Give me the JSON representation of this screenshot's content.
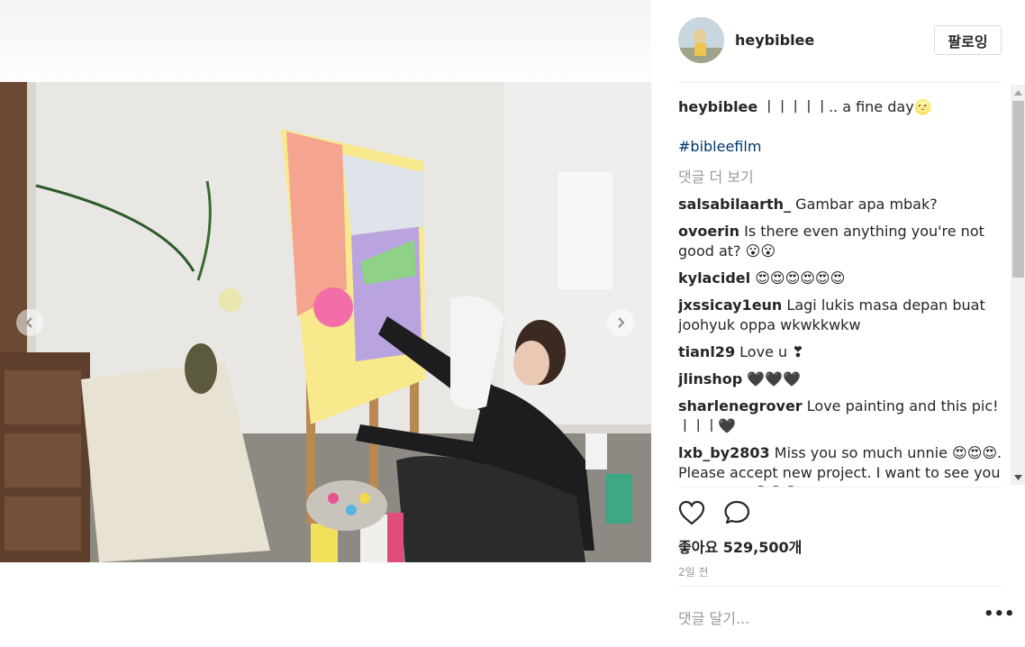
{
  "post": {
    "username": "heybiblee",
    "follow_label": "팔로잉",
    "caption_user": "heybiblee",
    "caption_text": "ㅣㅣㅣㅣㅣ.. a fine day🌝",
    "hashtag": "#bibleefilm",
    "more_comments": "댓글 더 보기",
    "comments": [
      {
        "user": "salsabilaarth_",
        "text": "Gambar apa mbak?"
      },
      {
        "user": "ovoerin",
        "text": "Is there even anything you're not good at? 😮😮"
      },
      {
        "user": "kylacidel",
        "text": "😍😍😍😍😍😍"
      },
      {
        "user": "jxssicay1eun",
        "text": "Lagi lukis masa depan buat joohyuk oppa wkwkkwkw"
      },
      {
        "user": "tianl29",
        "text": "Love u ❣"
      },
      {
        "user": "jlinshop",
        "text": "🖤🖤🖤"
      },
      {
        "user": "sharlenegrover",
        "text": "Love painting and this pic! ㅣㅣㅣ🖤"
      },
      {
        "user": "lxb_by2803",
        "text": "Miss you so much unnie 😍😍😍. Please accept new project. I want to see you on screen 😢😢😢"
      }
    ],
    "likes": "좋아요 529,500개",
    "time": "2일 전",
    "comment_placeholder": "댓글 달기...",
    "more_options": "•••"
  },
  "icons": {
    "like": "heart-outline-icon",
    "comment": "speech-bubble-icon",
    "prev": "chevron-left-icon",
    "next": "chevron-right-icon"
  }
}
